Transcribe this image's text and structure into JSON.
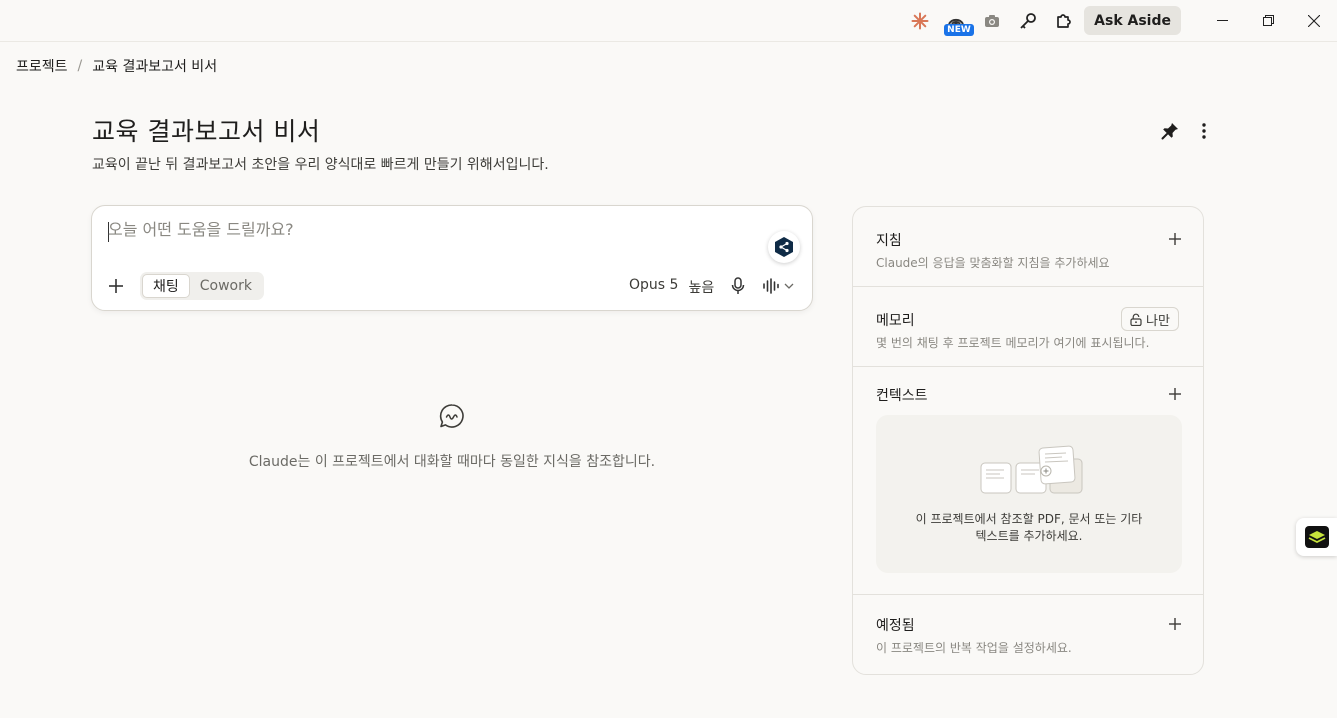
{
  "titlebar": {
    "new_badge": "NEW",
    "ask_aside": "Ask Aside",
    "icons": [
      "claude-spark-icon",
      "extension-new-icon",
      "camera-icon",
      "key-icon",
      "puzzle-icon"
    ]
  },
  "breadcrumb": {
    "root": "프로젝트",
    "separator": "/",
    "current": "교육 결과보고서 비서"
  },
  "project": {
    "title": "교육 결과보고서 비서",
    "description": "교육이 끝난 뒤 결과보고서 초안을 우리 양식대로 빠르게 만들기 위해서입니다."
  },
  "composer": {
    "placeholder": "오늘 어떤 도움을 드릴까요?",
    "value": "",
    "modes": [
      "채팅",
      "Cowork"
    ],
    "active_mode": "채팅",
    "model": "Opus 5",
    "effort": "높음"
  },
  "empty_state": {
    "text": "Claude는 이 프로젝트에서 대화할 때마다 동일한 지식을 참조합니다."
  },
  "side_panel": {
    "instructions": {
      "title": "지침",
      "subtitle": "Claude의 응답을 맞춤화할 지침을 추가하세요"
    },
    "memory": {
      "title": "메모리",
      "badge": "나만",
      "subtitle": "몇 번의 채팅 후 프로젝트 메모리가 여기에 표시됩니다."
    },
    "context": {
      "title": "컨텍스트",
      "drop_text_1": "이 프로젝트에서 참조할 PDF, 문서 또는 기타",
      "drop_text_2": "텍스트를 추가하세요."
    },
    "scheduled": {
      "title": "예정됨",
      "subtitle": "이 프로젝트의 반복 작업을 설정하세요."
    }
  },
  "colors": {
    "background": "#faf9f7",
    "accent_spark": "#d97757",
    "new_badge": "#1a73e8"
  }
}
